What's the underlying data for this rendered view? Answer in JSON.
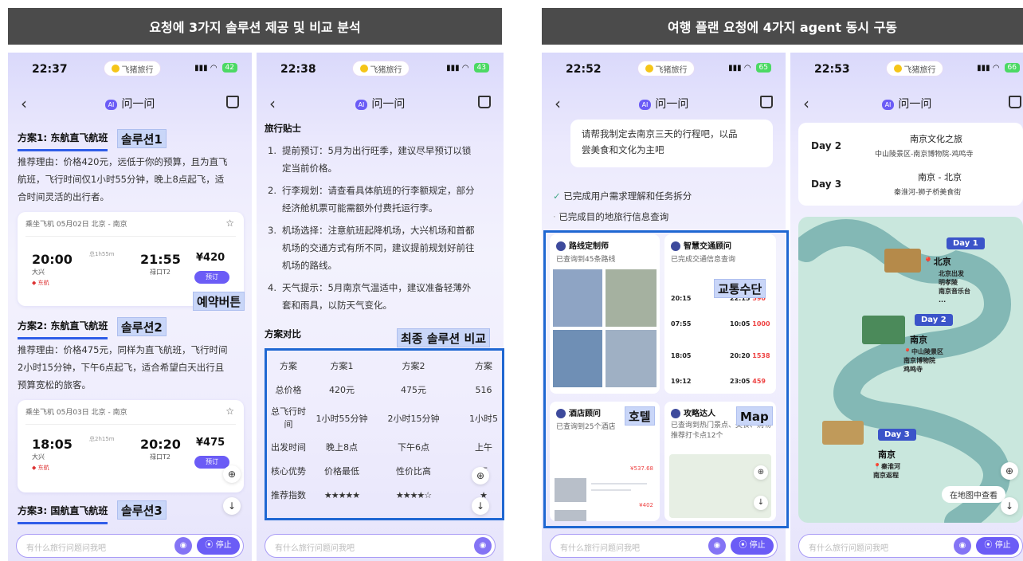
{
  "banners": {
    "left": "요청에 3가지 솔루션 제공 및 비교 분석",
    "right": "여행 플랜 요청에 4가지 agent 동시 구동"
  },
  "common": {
    "app_badge": "飞猪旅行",
    "nav_title": "问一问",
    "stop_label": "⦿ 停止"
  },
  "phone1": {
    "time": "22:37",
    "battery": "42",
    "sol1_title": "方案1: 东航直飞航班",
    "sol1_tag": "솔루션1",
    "sol1_reason": [
      "推荐理由：价格420元，远低于你的预算，且为直飞",
      "航班，飞行时间仅1小时55分钟，晚上8点起飞，适",
      "合时间灵活的出行者。"
    ],
    "card1": {
      "header": "乘坐飞机 05月02日 北京 - 南京",
      "dep_time": "20:00",
      "arr_time": "21:55",
      "duration": "总1h55m",
      "dep_airport": "大兴",
      "arr_airport": "禄口T2",
      "airline": "东航",
      "price": "¥420",
      "book": "预订"
    },
    "book_tag": "예약버튼",
    "sol2_title": "方案2: 东航直飞航班",
    "sol2_tag": "솔루션2",
    "sol2_reason": [
      "推荐理由：价格475元，同样为直飞航班，飞行时间",
      "2小时15分钟，下午6点起飞，适合希望白天出行且",
      "预算宽松的旅客。"
    ],
    "card2": {
      "header": "乘坐飞机 05月03日 北京 - 南京",
      "dep_time": "18:05",
      "arr_time": "20:20",
      "duration": "总2h15m",
      "dep_airport": "大兴",
      "arr_airport": "禄口T2",
      "airline": "东航",
      "price": "¥475",
      "book": "预订"
    },
    "sol3_title": "方案3: 国航直飞航班",
    "sol3_tag": "솔루션3",
    "placeholder": "有什么旅行问题问我吧"
  },
  "phone2": {
    "time": "22:38",
    "battery": "43",
    "tips_title": "旅行贴士",
    "tips": [
      {
        "n": "1.",
        "lines": [
          "提前预订：5月为出行旺季，建议尽早预订以锁",
          "定当前价格。"
        ]
      },
      {
        "n": "2.",
        "lines": [
          "行李规划：请查看具体航班的行李额规定，部分",
          "经济舱机票可能需额外付费托运行李。"
        ]
      },
      {
        "n": "3.",
        "lines": [
          "机场选择：注意航班起降机场，大兴机场和首都",
          "机场的交通方式有所不同，建议提前规划好前往",
          "机场的路线。"
        ]
      },
      {
        "n": "4.",
        "lines": [
          "天气提示：5月南京气温适中，建议准备轻薄外",
          "套和雨具，以防天气变化。"
        ]
      }
    ],
    "compare_title": "方案对比",
    "compare_tag": "최종 솔루션 비교",
    "table": [
      [
        "方案",
        "方案1",
        "方案2",
        "方案"
      ],
      [
        "总价格",
        "420元",
        "475元",
        "516"
      ],
      [
        "总飞行时间",
        "1小时55分钟",
        "2小时15分钟",
        "1小时5"
      ],
      [
        "出发时间",
        "晚上8点",
        "下午6点",
        "上午"
      ],
      [
        "核心优势",
        "价格最低",
        "性价比高",
        "天"
      ],
      [
        "推荐指数",
        "★★★★★",
        "★★★★☆",
        "★"
      ]
    ],
    "placeholder": "有什么旅行问题问我吧"
  },
  "phone3": {
    "time": "22:52",
    "battery": "65",
    "user_msg": [
      "请帮我制定去南京三天的行程吧，以品",
      "尝美食和文化为主吧"
    ],
    "done1": "已完成用户需求理解和任务拆分",
    "done2": "已完成目的地旅行信息查询",
    "agents": [
      {
        "title": "路线定制师",
        "sub": "已查询到45条路线"
      },
      {
        "title": "智慧交通顾问",
        "sub": "已完成交通信息查询"
      },
      {
        "title": "酒店顾问",
        "sub": "已查询到25个酒店"
      },
      {
        "title": "攻略达人",
        "sub": "已查询到热门景点、美食、购物推荐打卡点12个"
      }
    ],
    "transport_rows": [
      [
        "20:15",
        "22:15",
        "590"
      ],
      [
        "07:55",
        "10:05",
        "1000"
      ],
      [
        "18:05",
        "20:20",
        "1538"
      ],
      [
        "19:12",
        "23:05",
        "459"
      ]
    ],
    "hotel_prices": [
      "537.68",
      "402"
    ],
    "tag_transport": "교통수단",
    "tag_hotel": "호텔",
    "tag_map": "Map",
    "placeholder": "有什么旅行问题问我吧"
  },
  "phone4": {
    "time": "22:53",
    "battery": "66",
    "days": [
      {
        "day": "Day 2",
        "title": "南京文化之旅",
        "sub": "中山陵景区-南京博物院-鸡鸣寺"
      },
      {
        "day": "Day 3",
        "title": "南京 - 北京",
        "sub": "秦淮河-狮子桥美食街"
      }
    ],
    "map": {
      "day1": "Day 1",
      "day1_city": "北京",
      "day1_items": [
        "北京出发",
        "明孝陵",
        "南京音乐台",
        "..."
      ],
      "day2": "Day 2",
      "day2_city": "南京",
      "day2_items": [
        "中山陵景区",
        "南京博物院",
        "鸡鸣寺"
      ],
      "day3": "Day 3",
      "day3_city": "南京",
      "day3_items": [
        "秦淮河",
        "南京返程"
      ],
      "view_label": "在地图中查看"
    },
    "placeholder": "有什么旅行问题问我吧"
  }
}
